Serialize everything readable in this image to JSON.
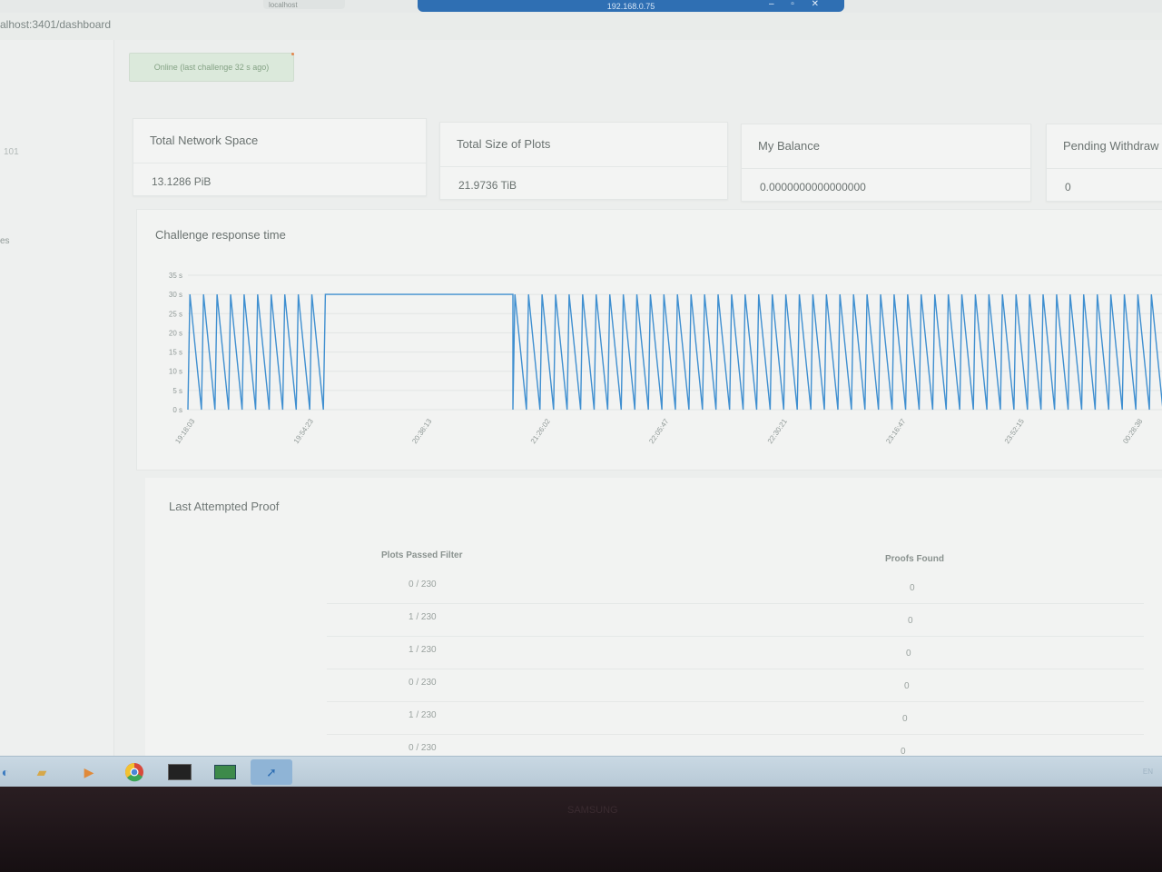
{
  "browser": {
    "tab_label": "localhost",
    "remote_title": "192.168.0.75",
    "remote_controls": "– ▫ ✕",
    "url": "alhost:3401/dashboard"
  },
  "sidebar": {
    "fragment_1": "101",
    "fragment_2": "es"
  },
  "status": {
    "text": "Online (last challenge 32 s ago)",
    "color": "#dbe9db"
  },
  "stats": [
    {
      "label": "Total Network Space",
      "value": "13.1286 PiB"
    },
    {
      "label": "Total Size of Plots",
      "value": "21.9736 TiB"
    },
    {
      "label": "My Balance",
      "value": "0.0000000000000000"
    },
    {
      "label": "Pending Withdraw",
      "value": "0"
    }
  ],
  "chart_title": "Challenge response time",
  "chart_data": {
    "type": "line",
    "title": "Challenge response time",
    "y_ticks": [
      "0 s",
      "5 s",
      "10 s",
      "15 s",
      "20 s",
      "25 s",
      "30 s",
      "35 s"
    ],
    "ylim": [
      0,
      35
    ],
    "x_ticks": [
      "19:18:03",
      "19:54:23",
      "20:38:13",
      "21:26:02",
      "22:05:47",
      "22:30:21",
      "23:16:47",
      "23:52:15",
      "00:28:38"
    ],
    "series": [
      {
        "color": "#3f8fd0",
        "segments": [
          {
            "pattern": "sawtooth",
            "peak": 30,
            "low": 0,
            "cycles": 11
          },
          {
            "pattern": "flat",
            "value": 30,
            "cycles": 1
          },
          {
            "pattern": "sawtooth",
            "peak": 30,
            "low": 0,
            "cycles": 48
          }
        ]
      }
    ],
    "grid": true
  },
  "proof": {
    "title": "Last Attempted Proof",
    "headers": [
      "Plots Passed Filter",
      "Proofs Found"
    ],
    "rows": [
      [
        "0 / 230",
        "0"
      ],
      [
        "1 / 230",
        "0"
      ],
      [
        "1 / 230",
        "0"
      ],
      [
        "0 / 230",
        "0"
      ],
      [
        "1 / 230",
        "0"
      ],
      [
        "0 / 230",
        "0"
      ]
    ]
  },
  "taskbar": {
    "items": [
      "ie-icon",
      "explorer-icon",
      "media-player-icon",
      "chrome-icon",
      "terminal-icon",
      "remote-desktop-icon",
      "active-app-icon"
    ],
    "lang": "EN"
  },
  "monitor_label": "SAMSUNG"
}
